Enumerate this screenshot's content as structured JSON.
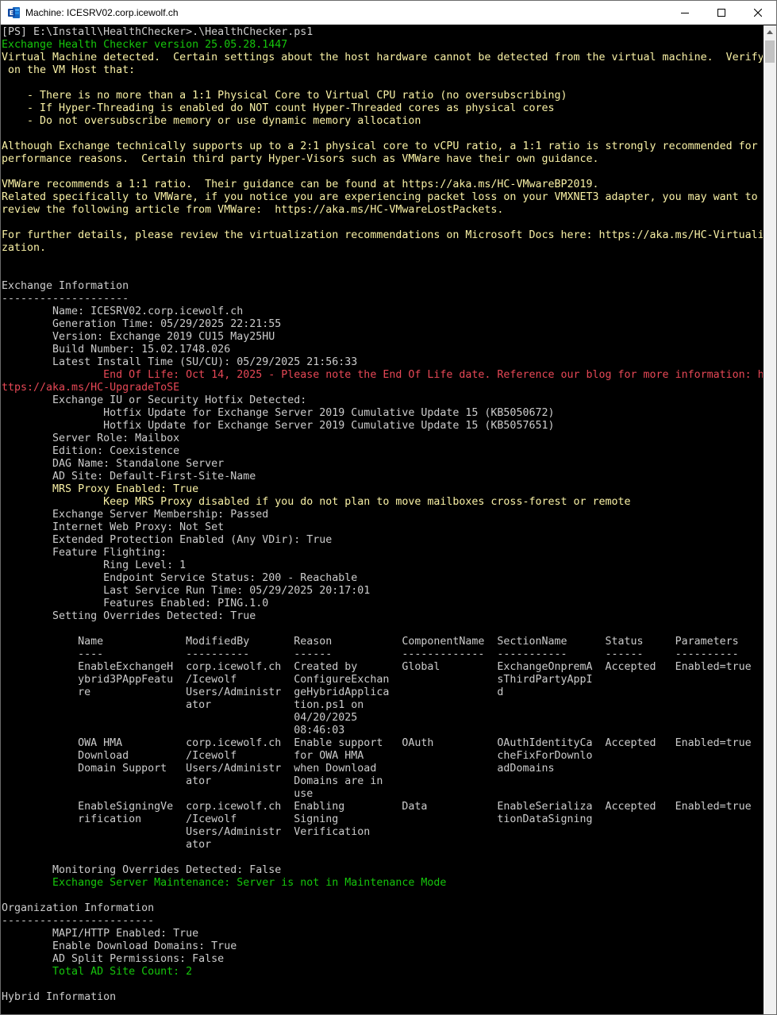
{
  "window": {
    "title": "Machine: ICESRV02.corp.icewolf.ch"
  },
  "console": {
    "lines": [
      {
        "t": "[PS] E:\\Install\\HealthChecker>.\\HealthChecker.ps1",
        "c": "white"
      },
      {
        "t": "Exchange Health Checker version 25.05.28.1447",
        "c": "green"
      },
      {
        "t": "Virtual Machine detected.  Certain settings about the host hardware cannot be detected from the virtual machine.  Verify",
        "c": "yellow"
      },
      {
        "t": " on the VM Host that:",
        "c": "yellow"
      },
      {
        "t": "",
        "c": "yellow"
      },
      {
        "t": "    - There is no more than a 1:1 Physical Core to Virtual CPU ratio (no oversubscribing)",
        "c": "yellow"
      },
      {
        "t": "    - If Hyper-Threading is enabled do NOT count Hyper-Threaded cores as physical cores",
        "c": "yellow"
      },
      {
        "t": "    - Do not oversubscribe memory or use dynamic memory allocation",
        "c": "yellow"
      },
      {
        "t": "",
        "c": "yellow"
      },
      {
        "t": "Although Exchange technically supports up to a 2:1 physical core to vCPU ratio, a 1:1 ratio is strongly recommended for",
        "c": "yellow"
      },
      {
        "t": "performance reasons.  Certain third party Hyper-Visors such as VMWare have their own guidance.",
        "c": "yellow"
      },
      {
        "t": "",
        "c": "yellow"
      },
      {
        "t": "VMWare recommends a 1:1 ratio.  Their guidance can be found at https://aka.ms/HC-VMwareBP2019.",
        "c": "yellow"
      },
      {
        "t": "Related specifically to VMWare, if you notice you are experiencing packet loss on your VMXNET3 adapter, you may want to",
        "c": "yellow"
      },
      {
        "t": "review the following article from VMWare:  https://aka.ms/HC-VMwareLostPackets.",
        "c": "yellow"
      },
      {
        "t": "",
        "c": "yellow"
      },
      {
        "t": "For further details, please review the virtualization recommendations on Microsoft Docs here: https://aka.ms/HC-Virtuali",
        "c": "yellow"
      },
      {
        "t": "zation.",
        "c": "yellow"
      },
      {
        "t": "",
        "c": "white"
      },
      {
        "t": "",
        "c": "white"
      },
      {
        "t": "Exchange Information",
        "c": "white"
      },
      {
        "t": "--------------------",
        "c": "white"
      },
      {
        "t": "        Name: ICESRV02.corp.icewolf.ch",
        "c": "white"
      },
      {
        "t": "        Generation Time: 05/29/2025 22:21:55",
        "c": "white"
      },
      {
        "t": "        Version: Exchange 2019 CU15 May25HU",
        "c": "white"
      },
      {
        "t": "        Build Number: 15.02.1748.026",
        "c": "white"
      },
      {
        "t": "        Latest Install Time (SU/CU): 05/29/2025 21:56:33",
        "c": "white"
      },
      {
        "t": "                End Of Life: Oct 14, 2025 - Please note the End Of Life date. Reference our blog for more information: h",
        "c": "red"
      },
      {
        "t": "ttps://aka.ms/HC-UpgradeToSE",
        "c": "red"
      },
      {
        "t": "        Exchange IU or Security Hotfix Detected:",
        "c": "white"
      },
      {
        "t": "                Hotfix Update for Exchange Server 2019 Cumulative Update 15 (KB5050672)",
        "c": "white"
      },
      {
        "t": "                Hotfix Update for Exchange Server 2019 Cumulative Update 15 (KB5057651)",
        "c": "white"
      },
      {
        "t": "        Server Role: Mailbox",
        "c": "white"
      },
      {
        "t": "        Edition: Coexistence",
        "c": "white"
      },
      {
        "t": "        DAG Name: Standalone Server",
        "c": "white"
      },
      {
        "t": "        AD Site: Default-First-Site-Name",
        "c": "white"
      },
      {
        "t": "        MRS Proxy Enabled: True",
        "c": "yellow"
      },
      {
        "t": "                Keep MRS Proxy disabled if you do not plan to move mailboxes cross-forest or remote",
        "c": "yellow"
      },
      {
        "t": "        Exchange Server Membership: Passed",
        "c": "white"
      },
      {
        "t": "        Internet Web Proxy: Not Set",
        "c": "white"
      },
      {
        "t": "        Extended Protection Enabled (Any VDir): True",
        "c": "white"
      },
      {
        "t": "        Feature Flighting:",
        "c": "white"
      },
      {
        "t": "                Ring Level: 1",
        "c": "white"
      },
      {
        "t": "                Endpoint Service Status: 200 - Reachable",
        "c": "white"
      },
      {
        "t": "                Last Service Run Time: 05/29/2025 20:17:01",
        "c": "white"
      },
      {
        "t": "                Features Enabled: PING.1.0",
        "c": "white"
      },
      {
        "t": "        Setting Overrides Detected: True",
        "c": "white"
      },
      {
        "t": "",
        "c": "white"
      },
      {
        "t": "            Name             ModifiedBy       Reason           ComponentName  SectionName      Status     Parameters",
        "c": "white"
      },
      {
        "t": "            ----             ----------       ------           -------------  -----------      ------     ----------",
        "c": "white"
      },
      {
        "t": "            EnableExchangeH  corp.icewolf.ch  Created by       Global         ExchangeOnpremA  Accepted   Enabled=true",
        "c": "white"
      },
      {
        "t": "            ybrid3PAppFeatu  /Icewolf         ConfigureExchan                 sThirdPartyAppI",
        "c": "white"
      },
      {
        "t": "            re               Users/Administr  geHybridApplica                 d",
        "c": "white"
      },
      {
        "t": "                             ator             tion.ps1 on",
        "c": "white"
      },
      {
        "t": "                                              04/20/2025",
        "c": "white"
      },
      {
        "t": "                                              08:46:03",
        "c": "white"
      },
      {
        "t": "            OWA HMA          corp.icewolf.ch  Enable support   OAuth          OAuthIdentityCa  Accepted   Enabled=true",
        "c": "white"
      },
      {
        "t": "            Download         /Icewolf         for OWA HMA                     cheFixForDownlo",
        "c": "white"
      },
      {
        "t": "            Domain Support   Users/Administr  when Download                   adDomains",
        "c": "white"
      },
      {
        "t": "                             ator             Domains are in",
        "c": "white"
      },
      {
        "t": "                                              use",
        "c": "white"
      },
      {
        "t": "            EnableSigningVe  corp.icewolf.ch  Enabling         Data           EnableSerializa  Accepted   Enabled=true",
        "c": "white"
      },
      {
        "t": "            rification       /Icewolf         Signing                         tionDataSigning",
        "c": "white"
      },
      {
        "t": "                             Users/Administr  Verification",
        "c": "white"
      },
      {
        "t": "                             ator",
        "c": "white"
      },
      {
        "t": "",
        "c": "white"
      },
      {
        "t": "        Monitoring Overrides Detected: False",
        "c": "white"
      },
      {
        "t": "        Exchange Server Maintenance: Server is not in Maintenance Mode",
        "c": "green"
      },
      {
        "t": "",
        "c": "white"
      },
      {
        "t": "Organization Information",
        "c": "white"
      },
      {
        "t": "------------------------",
        "c": "white"
      },
      {
        "t": "        MAPI/HTTP Enabled: True",
        "c": "white"
      },
      {
        "t": "        Enable Download Domains: True",
        "c": "white"
      },
      {
        "t": "        AD Split Permissions: False",
        "c": "white"
      },
      {
        "t": "        Total AD Site Count: 2",
        "c": "green"
      },
      {
        "t": "",
        "c": "white"
      },
      {
        "t": "Hybrid Information",
        "c": "white"
      }
    ]
  },
  "colors": {
    "white": "#cccccc",
    "green": "#16c60c",
    "yellow": "#f9f1a5",
    "red": "#e74856"
  },
  "icons": {
    "app": "exchange-app-icon",
    "minimize": "minimize-icon",
    "maximize": "maximize-icon",
    "close": "close-icon",
    "scroll_up": "scroll-up-arrow-icon"
  }
}
